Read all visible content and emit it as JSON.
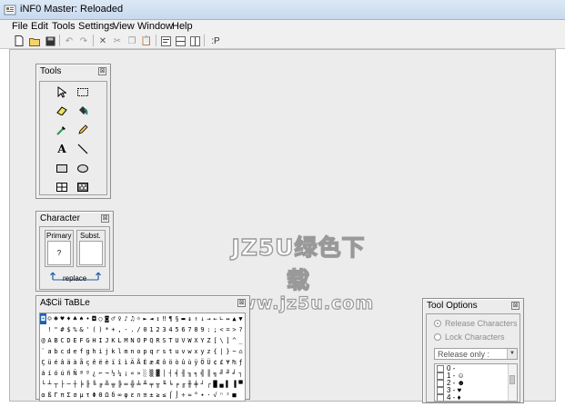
{
  "window": {
    "title": "iNF0 Master: Reloaded"
  },
  "menu": [
    "File",
    "Edit",
    "Tools",
    "Settings",
    "View",
    "Window",
    "Help"
  ],
  "toolbar": {
    "help_text": ":P"
  },
  "watermark": {
    "line1": "JZ5U绿色下载",
    "line2": "www.jz5u.com"
  },
  "tools_panel": {
    "title": "Tools",
    "close": "⊠",
    "text_tool": "A"
  },
  "character_panel": {
    "title": "Character",
    "primary_label": "Primary",
    "subst_label": "Subst.",
    "primary_value": "?",
    "replace_label": "replace"
  },
  "ascii_panel": {
    "title": "A$Cii TaBLe",
    "rows": [
      "◘☺☻♥♦♣♠•◘○◙♂♀♪♫☼►◄↕‼¶§▬↨↑↓→←∟↔▲▼",
      " !\"#$%&'()*+,-./0123456789:;<=>?",
      "@ABCDEFGHIJKLMNOPQRSTUVWXYZ[\\]^_",
      "`abcdefghijklmnopqrstuvwxyz{|}~⌂",
      "ÇüéâäàåçêëèïîìÄÅÉæÆôöòûùÿÖÜ¢£¥₧ƒ",
      "áíóúñÑªº¿⌐¬½¼¡«»░▒▓│┤╡╢╖╕╣║╗╝╜╛┐",
      "└┴┬├─┼╞╟╚╔╩╦╠═╬╧╨╤╥╙╘╒╓╫╪┘┌█▄▌▐▀",
      "αßΓπΣσµτΦΘΩδ∞φε∩≡±≥≤⌠⌡÷≈°∙·√ⁿ²■ "
    ]
  },
  "tool_options": {
    "title": "Tool Options",
    "release_label": "Release Characters",
    "lock_label": "Lock Characters",
    "dropdown_value": "Release only :",
    "lock_items": [
      "0 -",
      "1 - ☺",
      "2 - ☻",
      "3 - ♥",
      "4 - ♦"
    ]
  }
}
